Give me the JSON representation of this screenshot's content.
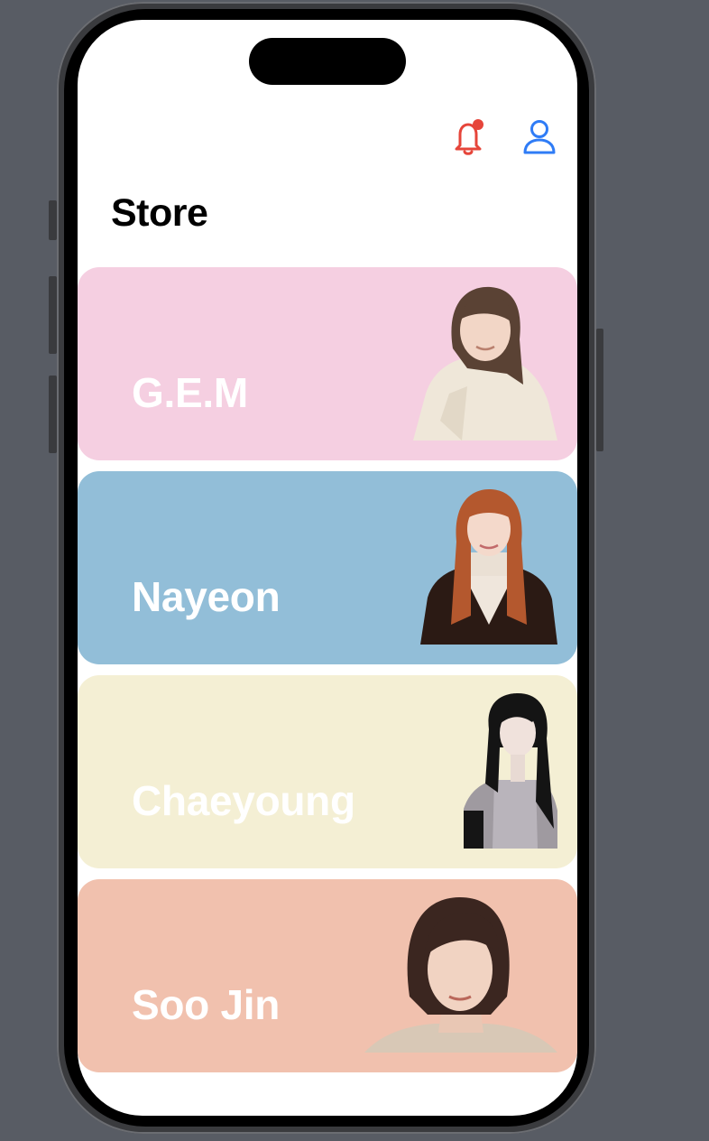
{
  "screen": {
    "title": "Store"
  },
  "header": {
    "notification_icon": "bell-icon",
    "notification_color": "#e6453a",
    "profile_icon": "person-icon",
    "profile_color": "#2f7cf6"
  },
  "cards": [
    {
      "name": "G.E.M",
      "color": "#f5cfe1"
    },
    {
      "name": "Nayeon",
      "color": "#92bed8"
    },
    {
      "name": "Chaeyoung",
      "color": "#f4efd4"
    },
    {
      "name": "Soo Jin",
      "color": "#f1c1ae"
    }
  ]
}
